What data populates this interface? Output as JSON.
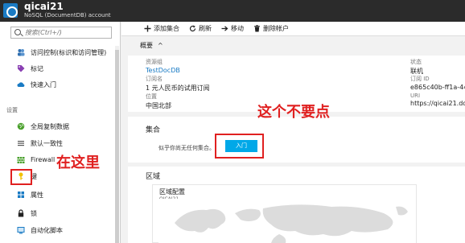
{
  "window": {
    "title": "qicai21",
    "subtitle": "NoSQL (DocumentDB) account"
  },
  "sidebar": {
    "search_placeholder": "搜索(Ctrl+/)",
    "items": [
      {
        "label": "访问控制(标识和访问管理)",
        "icon": "people-icon",
        "color": "#2f6fb0"
      },
      {
        "label": "标记",
        "icon": "tag-icon",
        "color": "#8a3fb3"
      },
      {
        "label": "快速入门",
        "icon": "cloud-icon",
        "color": "#1a7bc4"
      }
    ],
    "section_settings": "设置",
    "settings_items": [
      {
        "label": "全局复制数据",
        "icon": "globe-icon",
        "color": "#4aa02c"
      },
      {
        "label": "默认一致性",
        "icon": "lines-icon",
        "color": "#555555"
      },
      {
        "label": "Firewall",
        "icon": "firewall-icon",
        "color": "#4aa02c"
      },
      {
        "label": "键",
        "icon": "key-icon",
        "color": "#f2c200"
      },
      {
        "label": "属性",
        "icon": "properties-icon",
        "color": "#1a7bc4"
      },
      {
        "label": "锁",
        "icon": "lock-icon",
        "color": "#222222"
      },
      {
        "label": "自动化脚本",
        "icon": "script-icon",
        "color": "#1a7bc4"
      }
    ]
  },
  "toolbar": {
    "add_collection": "添加集合",
    "refresh": "刷新",
    "move": "移动",
    "delete_account": "删除帐户"
  },
  "essentials": {
    "label": "概要",
    "fields": [
      {
        "key": "资源组",
        "value": "TestDocDB",
        "link": true
      },
      {
        "key": "订阅名",
        "value": "1 元人民币的试用订阅",
        "link": false
      },
      {
        "key": "位置",
        "value": "中国北部",
        "link": false
      },
      {
        "key": "状态",
        "value": "联机",
        "link": false
      },
      {
        "key": "订阅 ID",
        "value": "e865c40b-ff1a-44",
        "link": false
      },
      {
        "key": "URI",
        "value": "https://qicai21.do",
        "link": false
      }
    ]
  },
  "collections": {
    "title": "集合",
    "hint": "似乎你尚无任何集合。",
    "start_button": "入门"
  },
  "regions": {
    "title": "区域",
    "card_title": "区域配置",
    "card_sub": "QICAI21"
  },
  "annotations": {
    "not_click": "这个不要点",
    "here": "在这里"
  },
  "colors": {
    "accent": "#00a8e8",
    "link": "#1a7bc4",
    "annotation": "#e02020",
    "titlebar": "#2b2b2b"
  }
}
